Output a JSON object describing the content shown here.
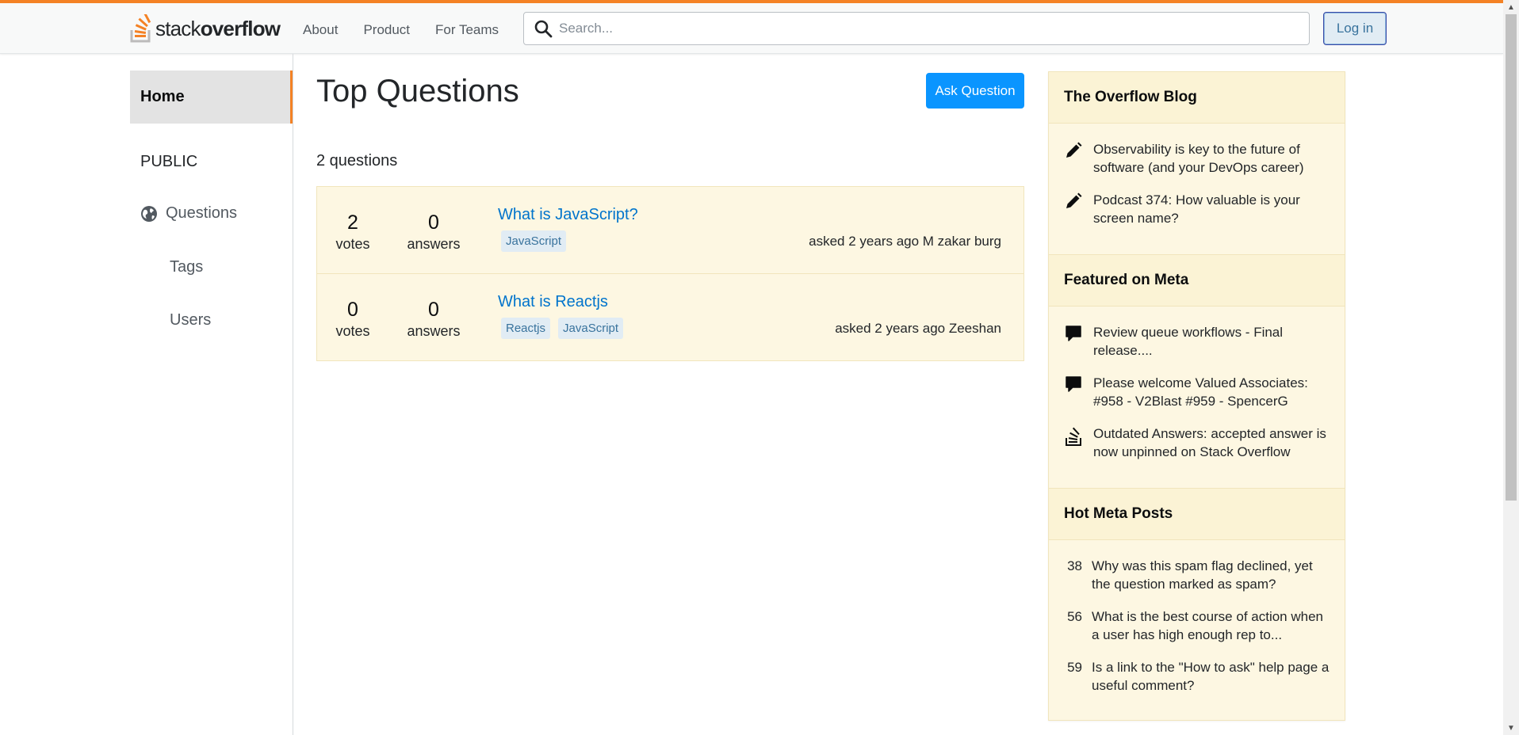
{
  "header": {
    "logo_word_light": "stack",
    "logo_word_bold": "overflow",
    "nav": [
      "About",
      "Product",
      "For Teams"
    ],
    "search_placeholder": "Search...",
    "login_label": "Log in"
  },
  "left_nav": {
    "home": "Home",
    "public": "PUBLIC",
    "questions": "Questions",
    "tags": "Tags",
    "users": "Users"
  },
  "main": {
    "title": "Top Questions",
    "ask_label": "Ask Question",
    "count": "2 questions",
    "questions": [
      {
        "votes": "2",
        "votes_label": "votes",
        "answers": "0",
        "answers_label": "answers",
        "title": "What is JavaScript?",
        "tags": [
          "JavaScript"
        ],
        "meta": "asked 2 years ago M zakar burg"
      },
      {
        "votes": "0",
        "votes_label": "votes",
        "answers": "0",
        "answers_label": "answers",
        "title": "What is Reactjs",
        "tags": [
          "Reactjs",
          "JavaScript"
        ],
        "meta": "asked 2 years ago Zeeshan"
      }
    ]
  },
  "sidebar": {
    "blog": {
      "title": "The Overflow Blog",
      "items": [
        {
          "icon": "pencil-icon",
          "text": "Observability is key to the future of software (and your DevOps career)"
        },
        {
          "icon": "pencil-icon",
          "text": "Podcast 374: How valuable is your screen name?"
        }
      ]
    },
    "meta": {
      "title": "Featured on Meta",
      "items": [
        {
          "icon": "comment-icon",
          "text": "Review queue workflows - Final release...."
        },
        {
          "icon": "comment-icon",
          "text": "Please welcome Valued Associates: #958 - V2Blast #959 - SpencerG"
        },
        {
          "icon": "stack-exchange-icon",
          "text": "Outdated Answers: accepted answer is now unpinned on Stack Overflow"
        }
      ]
    },
    "hot": {
      "title": "Hot Meta Posts",
      "items": [
        {
          "num": "38",
          "text": "Why was this spam flag declined, yet the question marked as spam?"
        },
        {
          "num": "56",
          "text": "What is the best course of action when a user has high enough rep to..."
        },
        {
          "num": "59",
          "text": "Is a link to the \"How to ask\" help page a useful comment?"
        }
      ]
    }
  },
  "colors": {
    "accent": "#f48225",
    "link": "#0074cc",
    "primary_button": "#0a95ff",
    "widget_bg": "#fdf7e2"
  }
}
